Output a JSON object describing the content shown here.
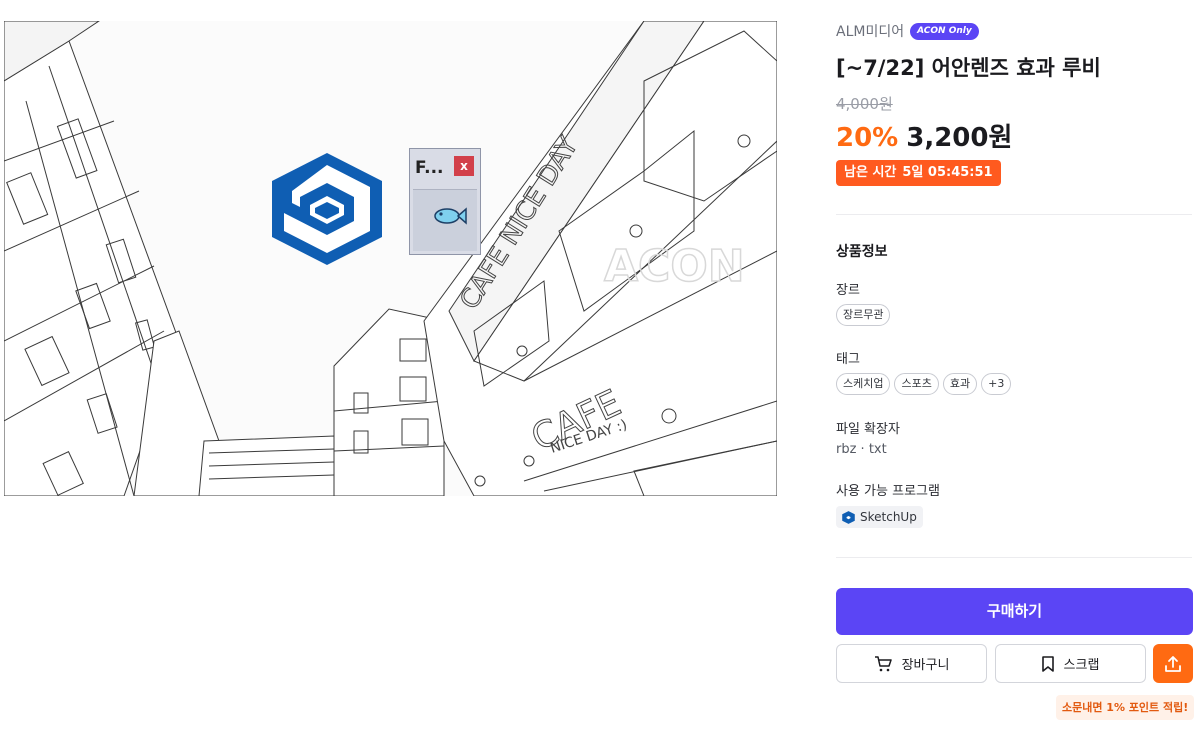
{
  "image": {
    "overlay_window_title": "F...",
    "overlay_window_close": "x",
    "watermark": "ACON",
    "sign_main": "CAFE NICE DAY",
    "sign_lower_1": "CAFE",
    "sign_lower_2": "NICE DAY :)"
  },
  "product": {
    "brand": "ALM미디어",
    "brand_badge": "ACON Only",
    "title": "[~7/22] 어안렌즈 효과 루비",
    "original_price": "4,000원",
    "discount": "20%",
    "sale_price": "3,200원",
    "timer_label": "남은 시간",
    "timer_value": "5일 05:45:51"
  },
  "details": {
    "section_title": "상품정보",
    "genre_label": "장르",
    "genre_chips": [
      "장르무관"
    ],
    "tags_label": "태그",
    "tag_chips": [
      "스케치업",
      "스포츠",
      "효과",
      "+3"
    ],
    "ext_label": "파일 확장자",
    "ext_value": "rbz · txt",
    "programs_label": "사용 가능 프로그램",
    "program": "SketchUp"
  },
  "actions": {
    "buy": "구매하기",
    "cart": "장바구니",
    "scrap": "스크랩",
    "promo": "소문내면 1% 포인트 적립!"
  },
  "colors": {
    "accent": "#5b45f5",
    "orange": "#ff6a12",
    "timer_bg": "#ff5a1f",
    "sketchup_blue": "#0f5eb3"
  }
}
